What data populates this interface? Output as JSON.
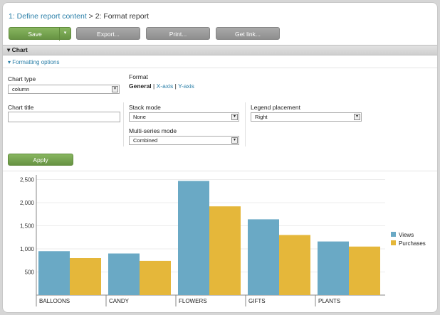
{
  "breadcrumb": {
    "step1": "1: Define report content",
    "separator": ">",
    "step2": "2: Format report"
  },
  "toolbar": {
    "save_label": "Save",
    "save_caret": "▾",
    "export_label": "Export...",
    "print_label": "Print...",
    "getlink_label": "Get link..."
  },
  "section": {
    "chart_toggle": "▾",
    "chart_title": "Chart",
    "formatting_toggle": "▾",
    "formatting_label": "Formatting options"
  },
  "form": {
    "chart_type_label": "Chart type",
    "chart_type_value": "column",
    "format_label": "Format",
    "format_general": "General",
    "format_sep1": "|",
    "format_xaxis": "X-axis",
    "format_sep2": "|",
    "format_yaxis": "Y-axis",
    "chart_title_label": "Chart title",
    "chart_title_value": "",
    "stack_mode_label": "Stack mode",
    "stack_mode_value": "None",
    "multi_series_label": "Multi-series mode",
    "multi_series_value": "Combined",
    "legend_placement_label": "Legend placement",
    "legend_placement_value": "Right",
    "select_arrow": "▾",
    "apply_label": "Apply"
  },
  "colors": {
    "views": "#6aa9c5",
    "purchases": "#e5b73a"
  },
  "chart_data": {
    "type": "bar",
    "categories": [
      "BALLOONS",
      "CANDY",
      "FLOWERS",
      "GIFTS",
      "PLANTS"
    ],
    "series": [
      {
        "name": "Views",
        "values": [
          950,
          900,
          2470,
          1640,
          1160
        ]
      },
      {
        "name": "Purchases",
        "values": [
          800,
          740,
          1920,
          1300,
          1050
        ]
      }
    ],
    "yticks": [
      "2,500",
      "2,000",
      "1,500",
      "1,000",
      "500"
    ],
    "ylim": [
      0,
      2600
    ],
    "legend_placement": "right",
    "grid": true
  }
}
